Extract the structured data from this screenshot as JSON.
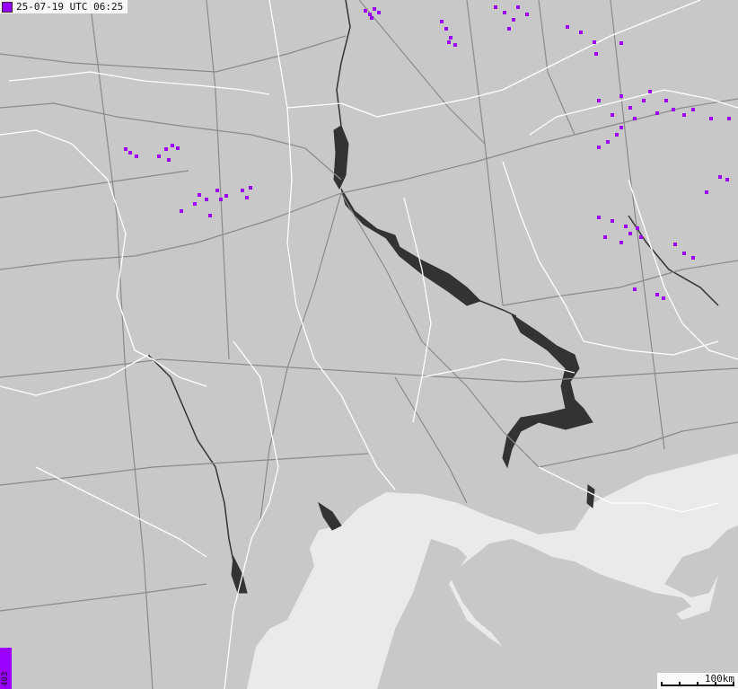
{
  "map": {
    "timestamp": "25-07-19 UTC 06:25",
    "strike_count": "403",
    "scale_label": "100km",
    "colors": {
      "land": "#c8c8c8",
      "sea": "#eaeaea",
      "water": "#333333",
      "roads": "#888888",
      "borders": "#ffffff",
      "strike": "#9b00ff"
    }
  }
}
